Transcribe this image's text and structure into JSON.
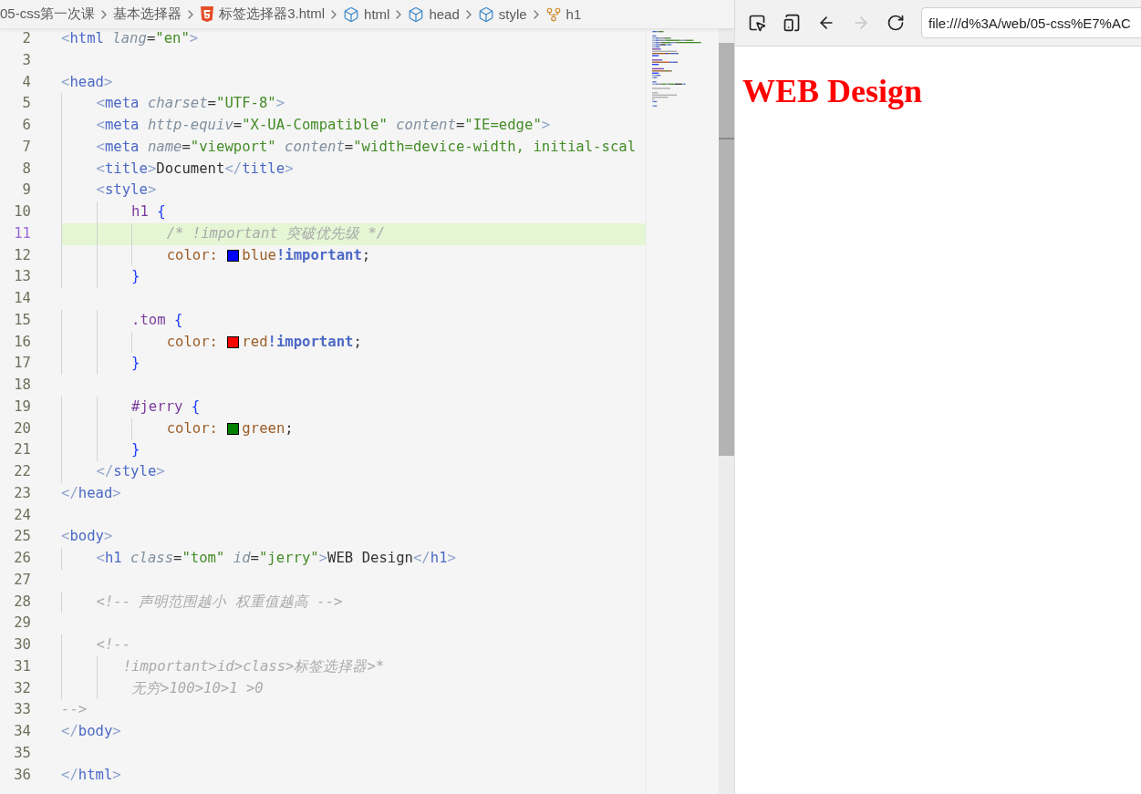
{
  "breadcrumb": [
    {
      "kind": "folder",
      "label": "05-css第一次课"
    },
    {
      "kind": "folder",
      "label": "基本选择器"
    },
    {
      "kind": "html-file",
      "label": "标签选择器3.html"
    },
    {
      "kind": "element",
      "label": "html"
    },
    {
      "kind": "element",
      "label": "head"
    },
    {
      "kind": "element",
      "label": "style"
    },
    {
      "kind": "selector",
      "label": "h1"
    }
  ],
  "editor": {
    "lines": [
      {
        "number": "2",
        "current": false,
        "tokens": [
          {
            "kind": "punct",
            "text": "<"
          },
          {
            "kind": "tag",
            "text": "html"
          },
          {
            "kind": "attr",
            "text": " lang"
          },
          {
            "kind": "plain",
            "text": "="
          },
          {
            "kind": "string",
            "text": "\"en\""
          },
          {
            "kind": "punct",
            "text": ">"
          }
        ]
      },
      {
        "number": "3",
        "current": false
      },
      {
        "number": "4",
        "current": false,
        "tokens": [
          {
            "kind": "punct",
            "text": "<"
          },
          {
            "kind": "tag",
            "text": "head"
          },
          {
            "kind": "punct",
            "text": ">"
          }
        ]
      },
      {
        "number": "5",
        "current": false,
        "tokens": [
          {
            "kind": "punct",
            "text": "    <"
          },
          {
            "kind": "tag",
            "text": "meta"
          },
          {
            "kind": "attr",
            "text": " charset"
          },
          {
            "kind": "plain",
            "text": "="
          },
          {
            "kind": "string",
            "text": "\"UTF-8\""
          },
          {
            "kind": "punct",
            "text": ">"
          }
        ]
      },
      {
        "number": "6",
        "current": false,
        "tokens": [
          {
            "kind": "punct",
            "text": "    <"
          },
          {
            "kind": "tag",
            "text": "meta"
          },
          {
            "kind": "attr",
            "text": " http-equiv"
          },
          {
            "kind": "plain",
            "text": "="
          },
          {
            "kind": "string",
            "text": "\"X-UA-Compatible\""
          },
          {
            "kind": "attr",
            "text": " content"
          },
          {
            "kind": "plain",
            "text": "="
          },
          {
            "kind": "string",
            "text": "\"IE=edge\""
          },
          {
            "kind": "punct",
            "text": ">"
          }
        ]
      },
      {
        "number": "7",
        "current": false,
        "tokens": [
          {
            "kind": "punct",
            "text": "    <"
          },
          {
            "kind": "tag",
            "text": "meta"
          },
          {
            "kind": "attr",
            "text": " name"
          },
          {
            "kind": "plain",
            "text": "="
          },
          {
            "kind": "string",
            "text": "\"viewport\""
          },
          {
            "kind": "attr",
            "text": " content"
          },
          {
            "kind": "plain",
            "text": "="
          },
          {
            "kind": "string",
            "text": "\"width=device-width, initial-scal"
          }
        ]
      },
      {
        "number": "8",
        "current": false,
        "tokens": [
          {
            "kind": "punct",
            "text": "    <"
          },
          {
            "kind": "tag",
            "text": "title"
          },
          {
            "kind": "punct",
            "text": ">"
          },
          {
            "kind": "plain",
            "text": "Document"
          },
          {
            "kind": "punct",
            "text": "</"
          },
          {
            "kind": "tag",
            "text": "title"
          },
          {
            "kind": "punct",
            "text": ">"
          }
        ]
      },
      {
        "number": "9",
        "current": false,
        "tokens": [
          {
            "kind": "punct",
            "text": "    <"
          },
          {
            "kind": "tag",
            "text": "style"
          },
          {
            "kind": "punct",
            "text": ">"
          }
        ]
      },
      {
        "number": "10",
        "current": false,
        "tokens": [
          {
            "kind": "selector",
            "text": "        h1 "
          },
          {
            "kind": "brace",
            "text": "{"
          }
        ]
      },
      {
        "number": "11",
        "current": true,
        "tokens": [
          {
            "kind": "comment",
            "text": "            /* !important 突破优先级 */"
          }
        ]
      },
      {
        "number": "12",
        "current": false,
        "tokens": [
          {
            "kind": "property",
            "text": "            color: "
          },
          {
            "kind": "swatch",
            "color": "#0000ff"
          },
          {
            "kind": "value",
            "text": "blue"
          },
          {
            "kind": "important",
            "text": "!important"
          },
          {
            "kind": "plain",
            "text": ";"
          }
        ]
      },
      {
        "number": "13",
        "current": false,
        "tokens": [
          {
            "kind": "brace",
            "text": "        }"
          }
        ]
      },
      {
        "number": "14",
        "current": false
      },
      {
        "number": "15",
        "current": false,
        "tokens": [
          {
            "kind": "selector",
            "text": "        .tom "
          },
          {
            "kind": "brace",
            "text": "{"
          }
        ]
      },
      {
        "number": "16",
        "current": false,
        "tokens": [
          {
            "kind": "property",
            "text": "            color: "
          },
          {
            "kind": "swatch",
            "color": "#ff0000"
          },
          {
            "kind": "value",
            "text": "red"
          },
          {
            "kind": "important",
            "text": "!important"
          },
          {
            "kind": "plain",
            "text": ";"
          }
        ]
      },
      {
        "number": "17",
        "current": false,
        "tokens": [
          {
            "kind": "brace",
            "text": "        }"
          }
        ]
      },
      {
        "number": "18",
        "current": false
      },
      {
        "number": "19",
        "current": false,
        "tokens": [
          {
            "kind": "selector",
            "text": "        #jerry "
          },
          {
            "kind": "brace",
            "text": "{"
          }
        ]
      },
      {
        "number": "20",
        "current": false,
        "tokens": [
          {
            "kind": "property",
            "text": "            color: "
          },
          {
            "kind": "swatch",
            "color": "#008000"
          },
          {
            "kind": "value",
            "text": "green"
          },
          {
            "kind": "plain",
            "text": ";"
          }
        ]
      },
      {
        "number": "21",
        "current": false,
        "tokens": [
          {
            "kind": "brace",
            "text": "        }"
          }
        ]
      },
      {
        "number": "22",
        "current": false,
        "tokens": [
          {
            "kind": "punct",
            "text": "    </"
          },
          {
            "kind": "tag",
            "text": "style"
          },
          {
            "kind": "punct",
            "text": ">"
          }
        ]
      },
      {
        "number": "23",
        "current": false,
        "tokens": [
          {
            "kind": "punct",
            "text": "</"
          },
          {
            "kind": "tag",
            "text": "head"
          },
          {
            "kind": "punct",
            "text": ">"
          }
        ]
      },
      {
        "number": "24",
        "current": false
      },
      {
        "number": "25",
        "current": false,
        "tokens": [
          {
            "kind": "punct",
            "text": "<"
          },
          {
            "kind": "tag",
            "text": "body"
          },
          {
            "kind": "punct",
            "text": ">"
          }
        ]
      },
      {
        "number": "26",
        "current": false,
        "tokens": [
          {
            "kind": "punct",
            "text": "    <"
          },
          {
            "kind": "tag",
            "text": "h1"
          },
          {
            "kind": "attr",
            "text": " class"
          },
          {
            "kind": "plain",
            "text": "="
          },
          {
            "kind": "string",
            "text": "\"tom\""
          },
          {
            "kind": "attr",
            "text": " id"
          },
          {
            "kind": "plain",
            "text": "="
          },
          {
            "kind": "string",
            "text": "\"jerry\""
          },
          {
            "kind": "punct",
            "text": ">"
          },
          {
            "kind": "plain",
            "text": "WEB Design"
          },
          {
            "kind": "punct",
            "text": "</"
          },
          {
            "kind": "tag",
            "text": "h1"
          },
          {
            "kind": "punct",
            "text": ">"
          }
        ]
      },
      {
        "number": "27",
        "current": false
      },
      {
        "number": "28",
        "current": false,
        "tokens": [
          {
            "kind": "comment",
            "text": "    <!-- 声明范围越小 权重值越高 -->"
          }
        ]
      },
      {
        "number": "29",
        "current": false
      },
      {
        "number": "30",
        "current": false,
        "tokens": [
          {
            "kind": "comment",
            "text": "    <!--"
          }
        ]
      },
      {
        "number": "31",
        "current": false,
        "tokens": [
          {
            "kind": "comment",
            "text": "       !important>id>class>标签选择器>*"
          }
        ]
      },
      {
        "number": "32",
        "current": false,
        "tokens": [
          {
            "kind": "comment",
            "text": "        无穷>100>10>1 >0"
          }
        ]
      },
      {
        "number": "33",
        "current": false,
        "tokens": [
          {
            "kind": "comment",
            "text": "-->"
          }
        ]
      },
      {
        "number": "34",
        "current": false,
        "tokens": [
          {
            "kind": "punct",
            "text": "</"
          },
          {
            "kind": "tag",
            "text": "body"
          },
          {
            "kind": "punct",
            "text": ">"
          }
        ]
      },
      {
        "number": "35",
        "current": false
      },
      {
        "number": "36",
        "current": false,
        "tokens": [
          {
            "kind": "punct",
            "text": "</"
          },
          {
            "kind": "tag",
            "text": "html"
          },
          {
            "kind": "punct",
            "text": ">"
          }
        ]
      }
    ]
  },
  "browser": {
    "toolbar": [
      {
        "kind": "inspect",
        "disabled": false
      },
      {
        "kind": "device",
        "disabled": false
      },
      {
        "kind": "back",
        "disabled": false
      },
      {
        "kind": "forward",
        "disabled": true
      },
      {
        "kind": "reload",
        "disabled": false
      }
    ],
    "address": "file:///d%3A/web/05-css%E7%AC",
    "heading": "WEB Design"
  }
}
